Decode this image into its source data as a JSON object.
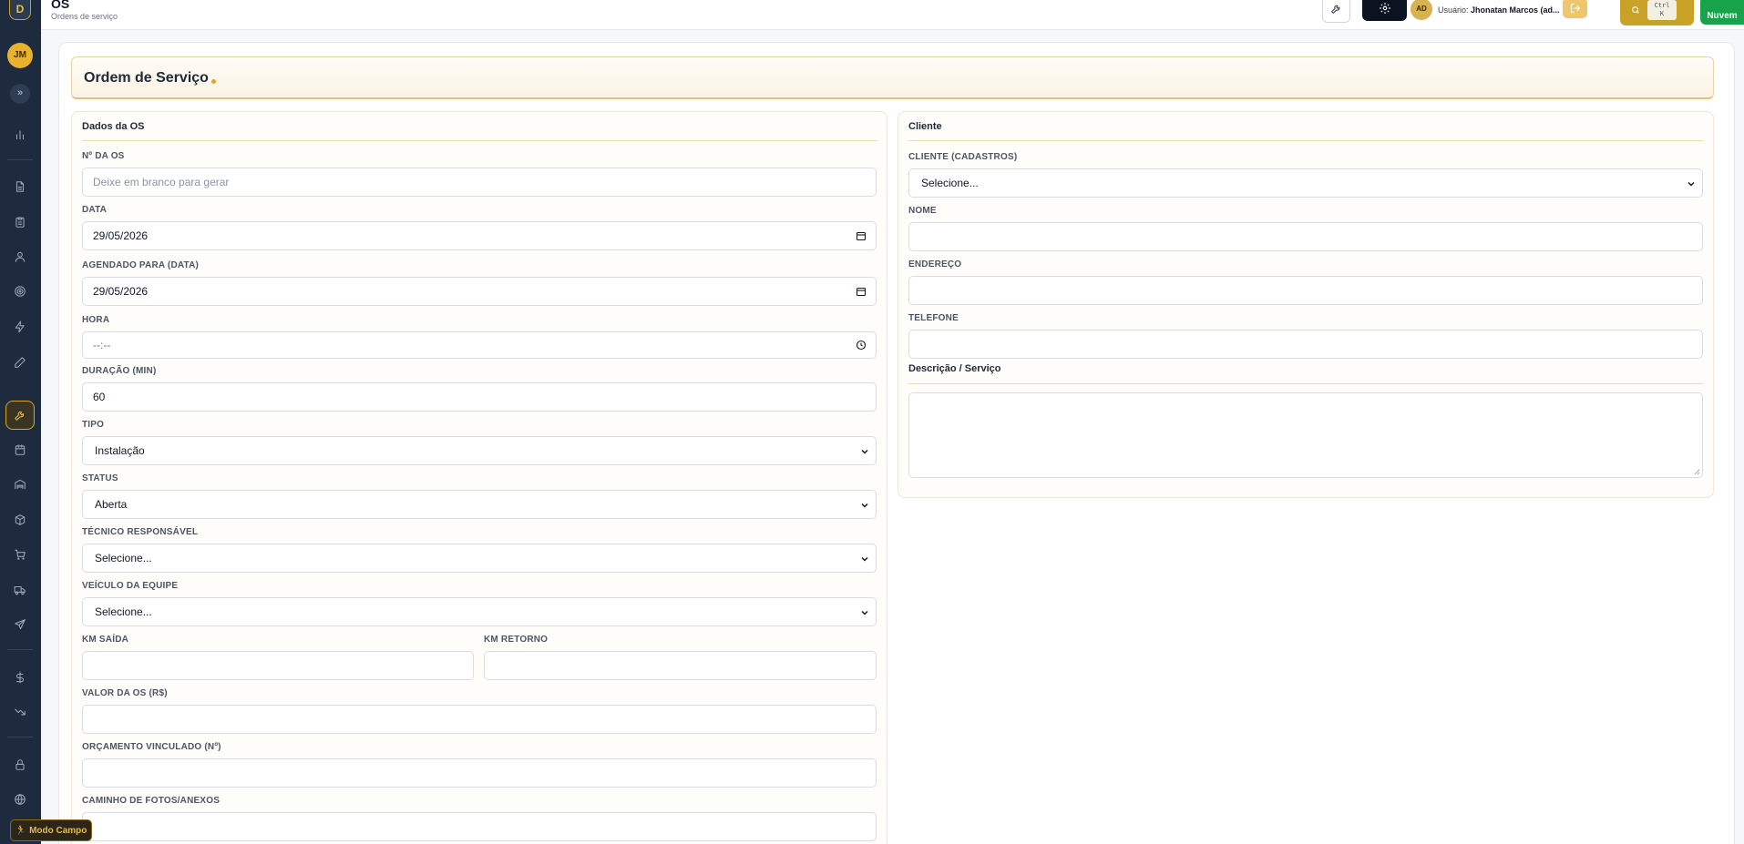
{
  "sidebar": {
    "logo": "D",
    "user_initials": "JM",
    "expand_glyph": "»",
    "icons": [
      "bar-chart-icon",
      "document-icon",
      "clipboard-icon",
      "user-icon",
      "target-icon",
      "lightning-icon",
      "pencil-icon",
      "wrench-icon",
      "calendar-icon",
      "warehouse-icon",
      "box-icon",
      "cart-icon",
      "truck-icon",
      "send-icon",
      "dollar-icon",
      "trend-icon",
      "lock-icon",
      "globe-icon"
    ],
    "modo_campo": "Modo Campo"
  },
  "header": {
    "title": "OS",
    "subtitle": "Ordens de serviço",
    "user_initials": "AD",
    "user_prefix": "Usuário:",
    "user_name": "Jhonatan Marcos (ad...",
    "kbd_line1": "Ctrl",
    "kbd_line2": "K",
    "new_label": "Nuvem"
  },
  "banner": {
    "title": "Ordem de Serviço"
  },
  "dados_os": {
    "section_title": "Dados da OS",
    "numero": {
      "label": "Nº DA OS",
      "placeholder": "Deixe em branco para gerar"
    },
    "data": {
      "label": "DATA",
      "value": "29/05/2026"
    },
    "agendado": {
      "label": "AGENDADO PARA (DATA)",
      "value": "29/05/2026"
    },
    "hora": {
      "label": "HORA",
      "value": "--:--"
    },
    "duracao": {
      "label": "DURAÇÃO (MIN)",
      "value": "60"
    },
    "tipo": {
      "label": "TIPO",
      "value": "Instalação"
    },
    "status": {
      "label": "STATUS",
      "value": "Aberta"
    },
    "tecnico": {
      "label": "TÉCNICO RESPONSÁVEL",
      "value": "Selecione..."
    },
    "veiculo": {
      "label": "VEÍCULO DA EQUIPE",
      "value": "Selecione..."
    },
    "km_saida": {
      "label": "KM SAÍDA",
      "value": ""
    },
    "km_retorno": {
      "label": "KM RETORNO",
      "value": ""
    },
    "valor": {
      "label": "VALOR DA OS (R$)",
      "value": ""
    },
    "orcamento": {
      "label": "ORÇAMENTO VINCULADO (Nº)",
      "value": ""
    },
    "fotos": {
      "label": "CAMINHO DE FOTOS/ANEXOS",
      "value": ""
    }
  },
  "cliente": {
    "section_title": "Cliente",
    "cadastro": {
      "label": "CLIENTE (CADASTROS)",
      "value": "Selecione..."
    },
    "nome": {
      "label": "NOME",
      "value": ""
    },
    "endereco": {
      "label": "ENDEREÇO",
      "value": ""
    },
    "telefone": {
      "label": "TELEFONE",
      "value": ""
    },
    "descricao_title": "Descrição / Serviço"
  },
  "colors": {
    "accent": "#c9a227",
    "sidebar": "#1e2a3d",
    "new_button": "#16a34a"
  }
}
